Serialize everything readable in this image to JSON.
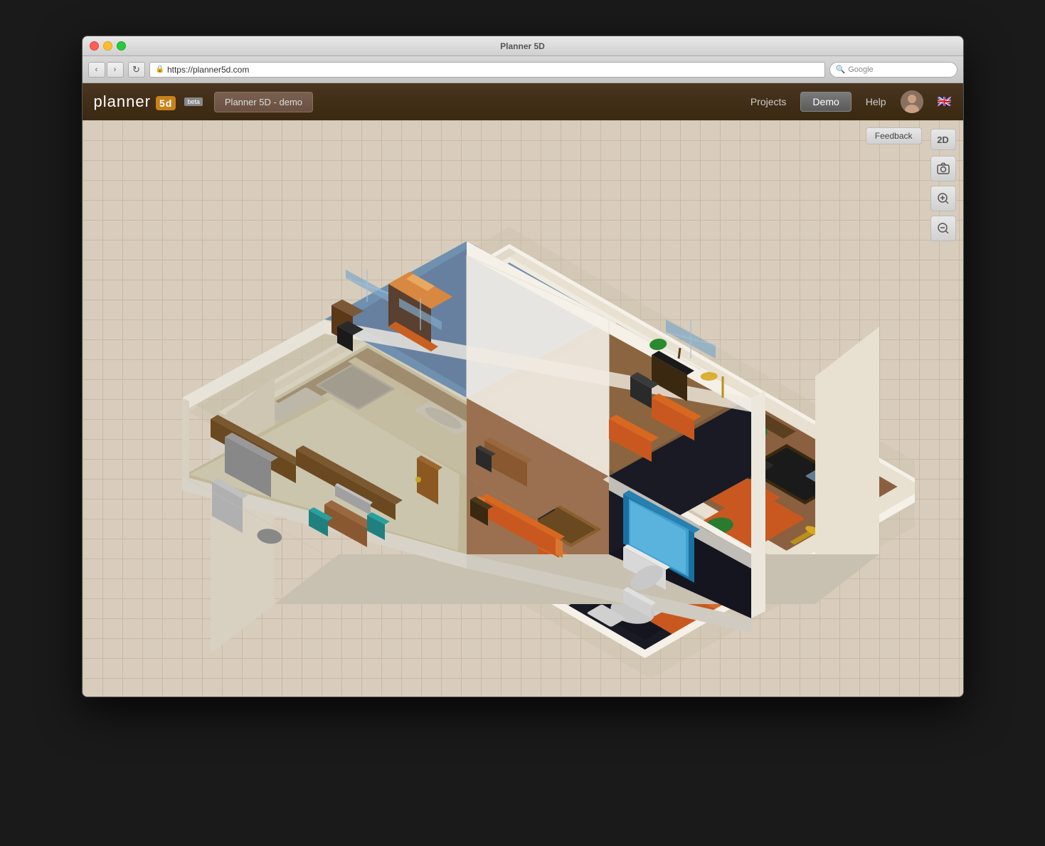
{
  "window": {
    "title": "Planner 5D",
    "traffic_lights": [
      "close",
      "minimize",
      "maximize"
    ]
  },
  "browser": {
    "back_label": "‹",
    "forward_label": "›",
    "reload_label": "↻",
    "url": "https://planner5d.com",
    "search_placeholder": "Google"
  },
  "header": {
    "logo_text_before": "planner",
    "logo_box": "5d",
    "beta_label": "beta",
    "project_name": "Planner 5D - demo",
    "nav_items": [
      "Projects",
      "Demo",
      "Help"
    ],
    "demo_button": "Demo"
  },
  "toolbar": {
    "feedback_label": "Feedback",
    "view_2d_label": "2D",
    "screenshot_icon": "camera",
    "zoom_in_icon": "zoom-in",
    "zoom_out_icon": "zoom-out"
  },
  "floorplan": {
    "description": "3D isometric apartment floor plan with multiple rooms including bedroom with blue carpet, office/study, kitchen, living room, hallway, and bathroom with blue bathtub",
    "rooms": [
      {
        "name": "bedroom",
        "color": "#a0b0c0"
      },
      {
        "name": "office",
        "color": "#8a7060"
      },
      {
        "name": "kitchen",
        "color": "#c8c0a8"
      },
      {
        "name": "hallway",
        "color": "#b8a890"
      },
      {
        "name": "living_room",
        "color": "#9a8870"
      },
      {
        "name": "bathroom",
        "color": "#1a1a2a"
      }
    ]
  },
  "colors": {
    "header_bg": "#3a2810",
    "grid_bg": "#d8ccbc",
    "wall_color": "#f5f0e8",
    "floor_wood": "#a0704a",
    "floor_tile": "#c8c0a8",
    "accent_orange": "#c85820",
    "furniture_dark": "#4a3520"
  }
}
